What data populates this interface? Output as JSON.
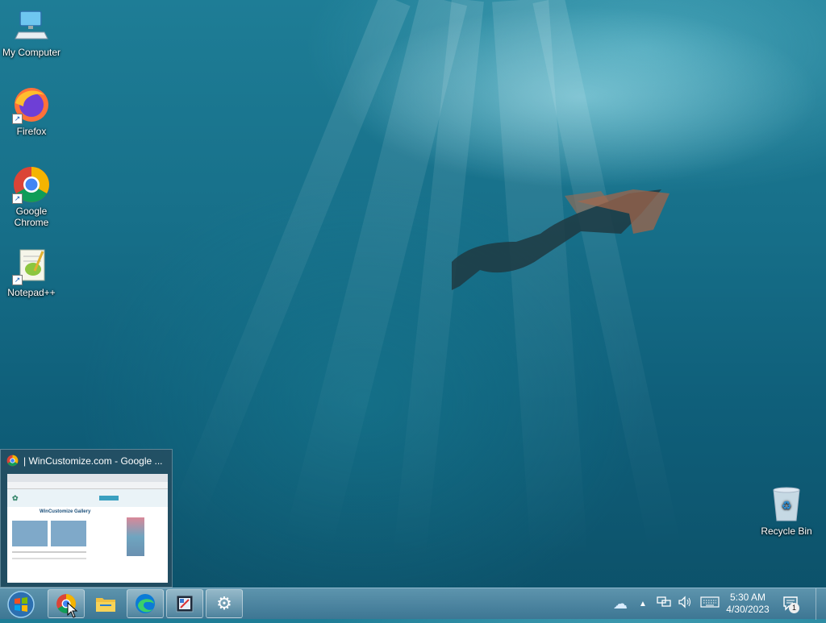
{
  "desktop": {
    "icons": [
      {
        "label": "My Computer",
        "icon": "computer-icon"
      },
      {
        "label": "Firefox",
        "icon": "firefox-icon"
      },
      {
        "label": "Google Chrome",
        "icon": "chrome-icon"
      },
      {
        "label": "Notepad++",
        "icon": "notepadpp-icon"
      },
      {
        "label": "Recycle Bin",
        "icon": "recycle-bin-icon"
      }
    ]
  },
  "preview": {
    "title": "| WinCustomize.com - Google ...",
    "thumb_heading": "WinCustomize Gallery"
  },
  "taskbar": {
    "pinned": [
      {
        "name": "chrome",
        "icon": "chrome-icon",
        "active": true
      },
      {
        "name": "file-explorer",
        "icon": "folder-icon",
        "active": false
      },
      {
        "name": "edge",
        "icon": "edge-icon",
        "active": true
      },
      {
        "name": "app",
        "icon": "app-icon",
        "active": true
      },
      {
        "name": "settings",
        "icon": "gear-icon",
        "active": true
      }
    ],
    "tray": {
      "weather_icon": "weather-icon",
      "notification_count": "1"
    },
    "clock": {
      "time": "5:30 AM",
      "date": "4/30/2023"
    }
  }
}
